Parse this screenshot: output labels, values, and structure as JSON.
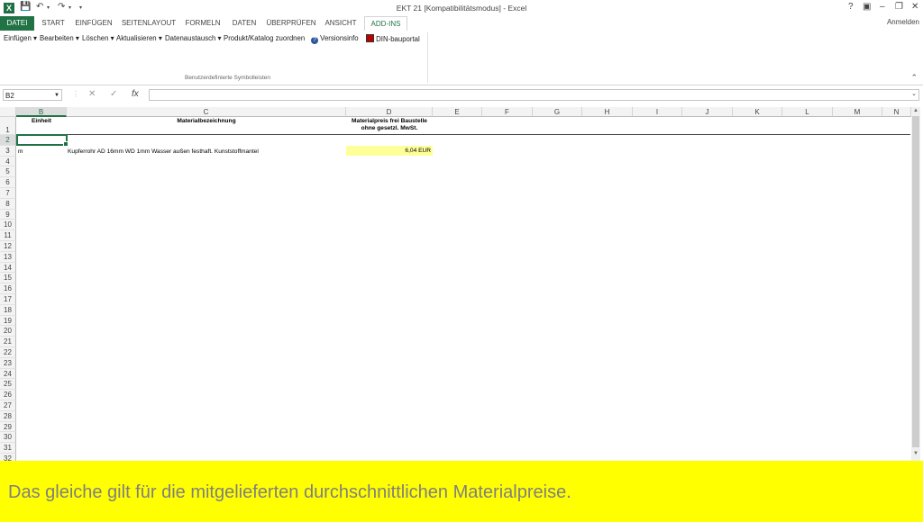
{
  "window": {
    "title": "EKT 21  [Kompatibilitätsmodus] - Excel",
    "signin": "Anmelden",
    "logo": "X",
    "controls": [
      "?",
      "▣",
      "–",
      "❐",
      "✕"
    ]
  },
  "quick_access": [
    "save-icon",
    "undo-icon",
    "redo-icon",
    "customize-icon"
  ],
  "tabs": [
    "DATEI",
    "START",
    "EINFÜGEN",
    "SEITENLAYOUT",
    "FORMELN",
    "DATEN",
    "ÜBERPRÜFEN",
    "ANSICHT",
    "ADD-INS"
  ],
  "ribbon": {
    "items": [
      "Einfügen",
      "Bearbeiten",
      "Löschen",
      "Aktualisieren",
      "Datenaustausch",
      "Produkt/Katalog zuordnen",
      "Versionsinfo",
      "DIN-bauportal"
    ],
    "group_label": "Benutzerdefinierte Symbolleisten"
  },
  "formula_bar": {
    "name_box": "B2",
    "cancel": "✕",
    "enter": "✓",
    "fx": "fx",
    "value": ""
  },
  "columns": [
    "B",
    "C",
    "D",
    "E",
    "F",
    "G",
    "H",
    "I",
    "J",
    "K",
    "L",
    "M",
    "N"
  ],
  "rows": [
    "1",
    "2",
    "3",
    "4",
    "5",
    "6",
    "7",
    "8",
    "9",
    "10",
    "11",
    "12",
    "13",
    "14",
    "15",
    "16",
    "17",
    "18",
    "19",
    "20",
    "21",
    "22",
    "23",
    "24",
    "25",
    "26",
    "27",
    "28",
    "29",
    "30",
    "31",
    "32"
  ],
  "sheet": {
    "header_einheit": "Einheit",
    "header_bezeichnung": "Materialbezeichnung",
    "header_preis": "Materialpreis frei Baustelle ohne gesetzl. MwSt.",
    "row3_einheit": "m",
    "row3_bezeichnung": "Kupferrohr AD 16mm WD 1mm Wasser außen festhaft. Kunststoffmantel",
    "row3_preis": "6,04 EUR"
  },
  "caption": "Das gleiche gilt für die mitgelieferten durchschnittlichen Materialpreise.",
  "colors": {
    "accent": "#217346",
    "price_fill": "#ffff99",
    "caption_bg": "#ffff00",
    "caption_text": "#7f7f7f"
  }
}
